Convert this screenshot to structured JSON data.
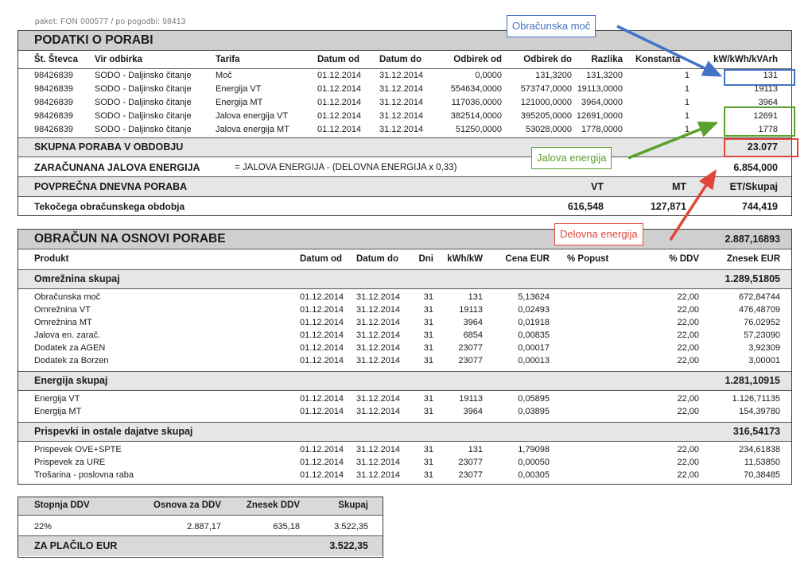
{
  "clip_text": "paket: FON 000577 / po pogodbi: 98413",
  "consumption": {
    "title": "PODATKI O PORABI",
    "headers": [
      "Št. Števca",
      "Vir odbirka",
      "Tarifa",
      "Datum od",
      "Datum do",
      "Odbirek od",
      "Odbirek do",
      "Razlika",
      "Konstanta",
      "kW/kWh/kVArh"
    ],
    "rows": [
      [
        "98426839",
        "SODO - Daljinsko čitanje",
        "Moč",
        "01.12.2014",
        "31.12.2014",
        "0,0000",
        "131,3200",
        "131,3200",
        "1",
        "131"
      ],
      [
        "98426839",
        "SODO - Daljinsko čitanje",
        "Energija VT",
        "01.12.2014",
        "31.12.2014",
        "554634,0000",
        "573747,0000",
        "19113,0000",
        "1",
        "19113"
      ],
      [
        "98426839",
        "SODO - Daljinsko čitanje",
        "Energija MT",
        "01.12.2014",
        "31.12.2014",
        "117036,0000",
        "121000,0000",
        "3964,0000",
        "1",
        "3964"
      ],
      [
        "98426839",
        "SODO - Daljinsko čitanje",
        "Jalova energija VT",
        "01.12.2014",
        "31.12.2014",
        "382514,0000",
        "395205,0000",
        "12691,0000",
        "1",
        "12691"
      ],
      [
        "98426839",
        "SODO - Daljinsko čitanje",
        "Jalova energija MT",
        "01.12.2014",
        "31.12.2014",
        "51250,0000",
        "53028,0000",
        "1778,0000",
        "1",
        "1778"
      ]
    ],
    "total_label": "SKUPNA PORABA V OBDOBJU",
    "total_value": "23.077",
    "reactive_label": "ZARAČUNANA JALOVA ENERGIJA",
    "reactive_formula": "= JALOVA ENERGIJA - (DELOVNA ENERGIJA x 0,33)",
    "reactive_value": "6.854,000",
    "avg_label": "POVPREČNA DNEVNA PORABA",
    "avg_cols": [
      "VT",
      "MT",
      "ET/Skupaj"
    ],
    "current_label": "Tekočega obračunskega obdobja",
    "current_values": [
      "616,548",
      "127,871",
      "744,419"
    ]
  },
  "billing": {
    "title": "OBRAČUN NA OSNOVI PORABE",
    "title_value": "2.887,16893",
    "headers": [
      "Produkt",
      "Datum od",
      "Datum do",
      "Dni",
      "kWh/kW",
      "Cena EUR",
      "% Popust",
      "% DDV",
      "Znesek EUR"
    ],
    "groups": [
      {
        "name": "Omrežnina skupaj",
        "total": "1.289,51805",
        "items": [
          [
            "Obračunska moč",
            "01.12.2014",
            "31.12.2014",
            "31",
            "131",
            "5,13624",
            "22,00",
            "672,84744"
          ],
          [
            "Omrežnina VT",
            "01.12.2014",
            "31.12.2014",
            "31",
            "19113",
            "0,02493",
            "22,00",
            "476,48709"
          ],
          [
            "Omrežnina MT",
            "01.12.2014",
            "31.12.2014",
            "31",
            "3964",
            "0,01918",
            "22,00",
            "76,02952"
          ],
          [
            "Jalova en. zarač.",
            "01.12.2014",
            "31.12.2014",
            "31",
            "6854",
            "0,00835",
            "22,00",
            "57,23090"
          ],
          [
            "Dodatek za AGEN",
            "01.12.2014",
            "31.12.2014",
            "31",
            "23077",
            "0,00017",
            "22,00",
            "3,92309"
          ],
          [
            "Dodatek za Borzen",
            "01.12.2014",
            "31.12.2014",
            "31",
            "23077",
            "0,00013",
            "22,00",
            "3,00001"
          ]
        ]
      },
      {
        "name": "Energija skupaj",
        "total": "1.281,10915",
        "items": [
          [
            "Energija VT",
            "01.12.2014",
            "31.12.2014",
            "31",
            "19113",
            "0,05895",
            "22,00",
            "1.126,71135"
          ],
          [
            "Energija MT",
            "01.12.2014",
            "31.12.2014",
            "31",
            "3964",
            "0,03895",
            "22,00",
            "154,39780"
          ]
        ]
      },
      {
        "name": "Prispevki in ostale dajatve skupaj",
        "total": "316,54173",
        "items": [
          [
            "Prispevek OVE+SPTE",
            "01.12.2014",
            "31.12.2014",
            "31",
            "131",
            "1,79098",
            "22,00",
            "234,61838"
          ],
          [
            "Prispevek za URE",
            "01.12.2014",
            "31.12.2014",
            "31",
            "23077",
            "0,00050",
            "22,00",
            "11,53850"
          ],
          [
            "Trošarina - poslovna raba",
            "01.12.2014",
            "31.12.2014",
            "31",
            "23077",
            "0,00305",
            "22,00",
            "70,38485"
          ]
        ]
      }
    ]
  },
  "vat": {
    "headers": [
      "Stopnja DDV",
      "Osnova za DDV",
      "Znesek DDV",
      "Skupaj"
    ],
    "row": [
      "22%",
      "2.887,17",
      "635,18",
      "3.522,35"
    ],
    "pay_label": "ZA PLAČILO EUR",
    "pay_value": "3.522,35"
  },
  "annotations": {
    "obracunska_moc": "Obračunska moč",
    "jalova_energija": "Jalova energija",
    "delovna_energija": "Delovna energija",
    "colors": {
      "blue": "#4472c4",
      "green": "#5aa02c",
      "red": "#e0463a"
    }
  }
}
